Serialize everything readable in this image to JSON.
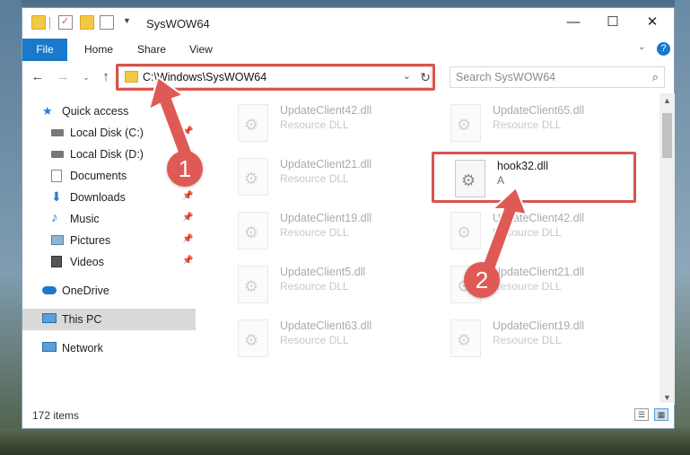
{
  "window": {
    "title": "SysWOW64"
  },
  "ribbon": {
    "file": "File",
    "home": "Home",
    "share": "Share",
    "view": "View"
  },
  "address": {
    "path": "C:\\Windows\\SysWOW64"
  },
  "search": {
    "placeholder": "Search SysWOW64"
  },
  "nav": {
    "items": [
      {
        "label": "Quick access",
        "icon": "star-icon"
      },
      {
        "label": "Local Disk (C:)",
        "icon": "drive-icon"
      },
      {
        "label": "Local Disk (D:)",
        "icon": "drive-icon"
      },
      {
        "label": "Documents",
        "icon": "documents-icon"
      },
      {
        "label": "Downloads",
        "icon": "download-icon"
      },
      {
        "label": "Music",
        "icon": "music-icon"
      },
      {
        "label": "Pictures",
        "icon": "pictures-icon"
      },
      {
        "label": "Videos",
        "icon": "videos-icon"
      },
      {
        "label": "OneDrive",
        "icon": "cloud-icon"
      },
      {
        "label": "This PC",
        "icon": "computer-icon"
      },
      {
        "label": "Network",
        "icon": "network-icon"
      }
    ]
  },
  "files": [
    {
      "name": "UpdateClient42.dll",
      "type": "Resource DLL"
    },
    {
      "name": "UpdateClient65.dll",
      "type": "Resource DLL"
    },
    {
      "name": "UpdateClient21.dll",
      "type": "Resource DLL"
    },
    {
      "name": "hook32.dll",
      "type": "A"
    },
    {
      "name": "UpdateClient19.dll",
      "type": "Resource DLL"
    },
    {
      "name": "UpdateClient42.dll",
      "type": "Resource DLL"
    },
    {
      "name": "UpdateClient5.dll",
      "type": "Resource DLL"
    },
    {
      "name": "UpdateClient21.dll",
      "type": "Resource DLL"
    },
    {
      "name": "UpdateClient63.dll",
      "type": "Resource DLL"
    },
    {
      "name": "UpdateClient19.dll",
      "type": "Resource DLL"
    }
  ],
  "status": {
    "count": "172 items"
  },
  "annotations": {
    "step1": "1",
    "step2": "2",
    "color": "#d9534f"
  }
}
